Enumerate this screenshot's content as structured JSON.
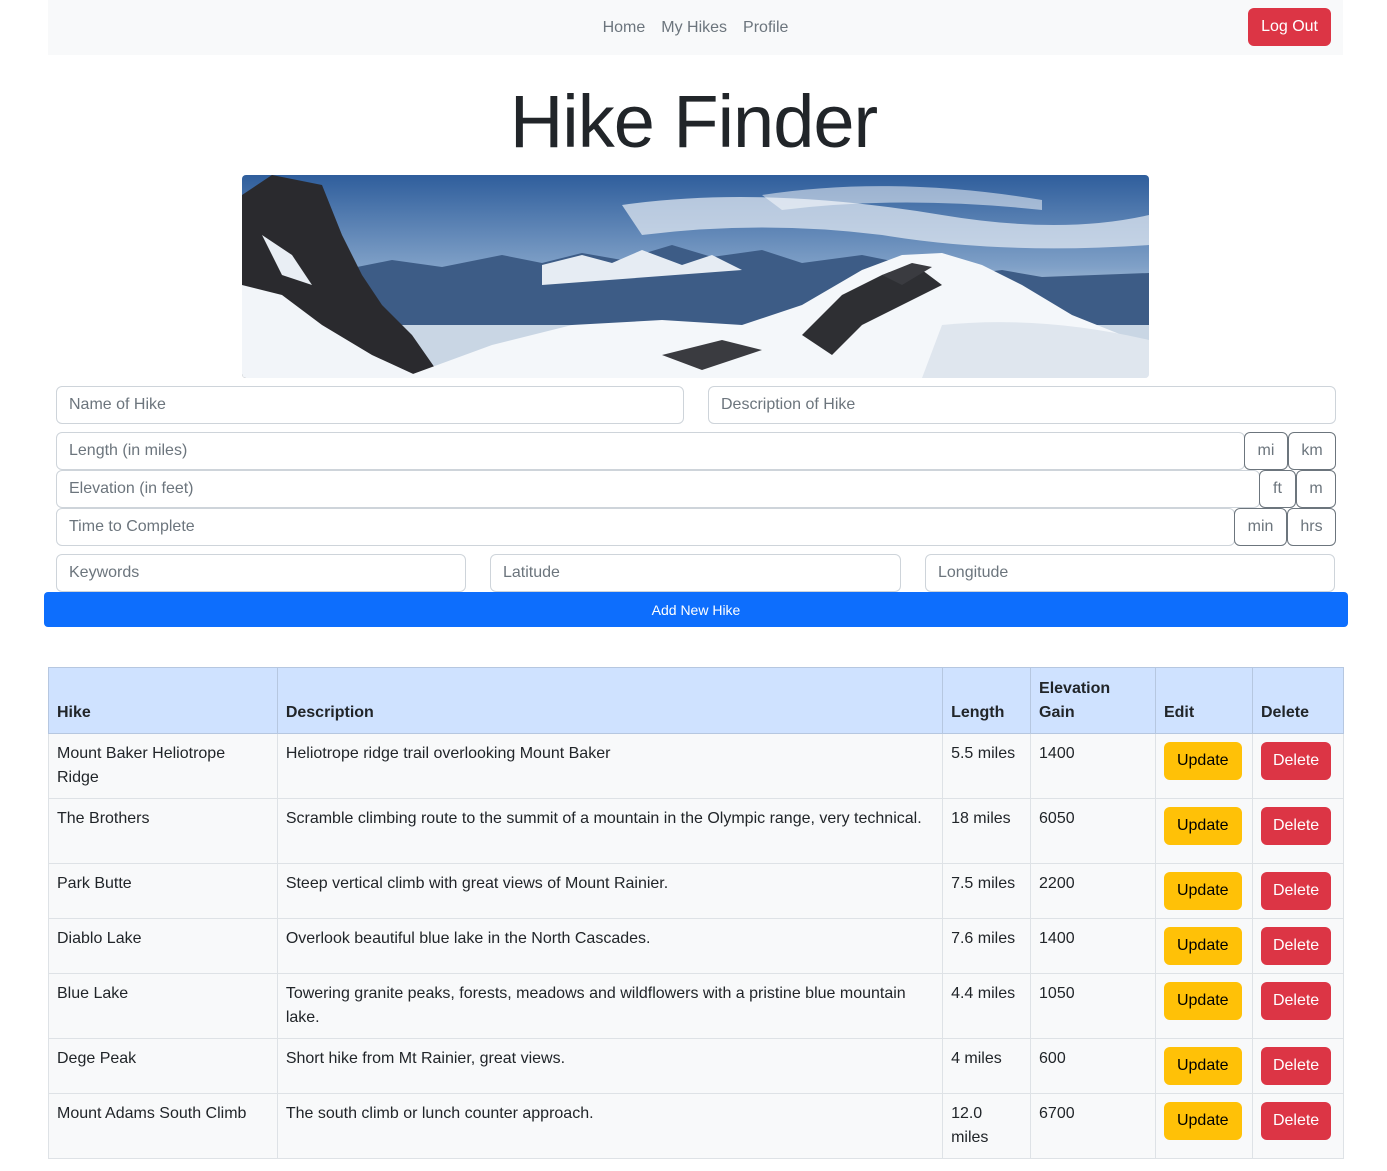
{
  "nav": {
    "links": [
      "Home",
      "My Hikes",
      "Profile"
    ],
    "logout_label": "Log Out"
  },
  "page_title": "Hike Finder",
  "form": {
    "name_placeholder": "Name of Hike",
    "description_placeholder": "Description of Hike",
    "length_placeholder": "Length (in miles)",
    "elevation_placeholder": "Elevation (in feet)",
    "time_placeholder": "Time to Complete",
    "keywords_placeholder": "Keywords",
    "latitude_placeholder": "Latitude",
    "longitude_placeholder": "Longitude",
    "length_units": [
      "mi",
      "km"
    ],
    "elevation_units": [
      "ft",
      "m"
    ],
    "time_units": [
      "min",
      "hrs"
    ],
    "submit_label": "Add New Hike"
  },
  "table": {
    "headers": [
      "Hike",
      "Description",
      "Length",
      "Elevation Gain",
      "Edit",
      "Delete"
    ],
    "update_label": "Update",
    "delete_label": "Delete",
    "rows": [
      {
        "hike": "Mount Baker Heliotrope Ridge",
        "description": "Heliotrope ridge trail overlooking Mount Baker",
        "length": "5.5 miles",
        "elevation": "1400"
      },
      {
        "hike": "The Brothers",
        "description": "Scramble climbing route to the summit of a mountain in the Olympic range, very technical.",
        "length": "18 miles",
        "elevation": "6050"
      },
      {
        "hike": "Park Butte",
        "description": "Steep vertical climb with great views of Mount Rainier.",
        "length": "7.5 miles",
        "elevation": "2200"
      },
      {
        "hike": "Diablo Lake",
        "description": "Overlook beautiful blue lake in the North Cascades.",
        "length": "7.6 miles",
        "elevation": "1400"
      },
      {
        "hike": "Blue Lake",
        "description": "Towering granite peaks, forests, meadows and wildflowers with a pristine blue mountain lake.",
        "length": "4.4 miles",
        "elevation": "1050"
      },
      {
        "hike": "Dege Peak",
        "description": "Short hike from Mt Rainier, great views.",
        "length": "4 miles",
        "elevation": "600"
      },
      {
        "hike": "Mount Adams South Climb",
        "description": "The south climb or lunch counter approach.",
        "length": "12.0 miles",
        "elevation": "6700"
      }
    ]
  },
  "colors": {
    "primary": "#0d6efd",
    "danger": "#dc3545",
    "warning": "#ffc107",
    "table_header": "#cfe2ff"
  }
}
